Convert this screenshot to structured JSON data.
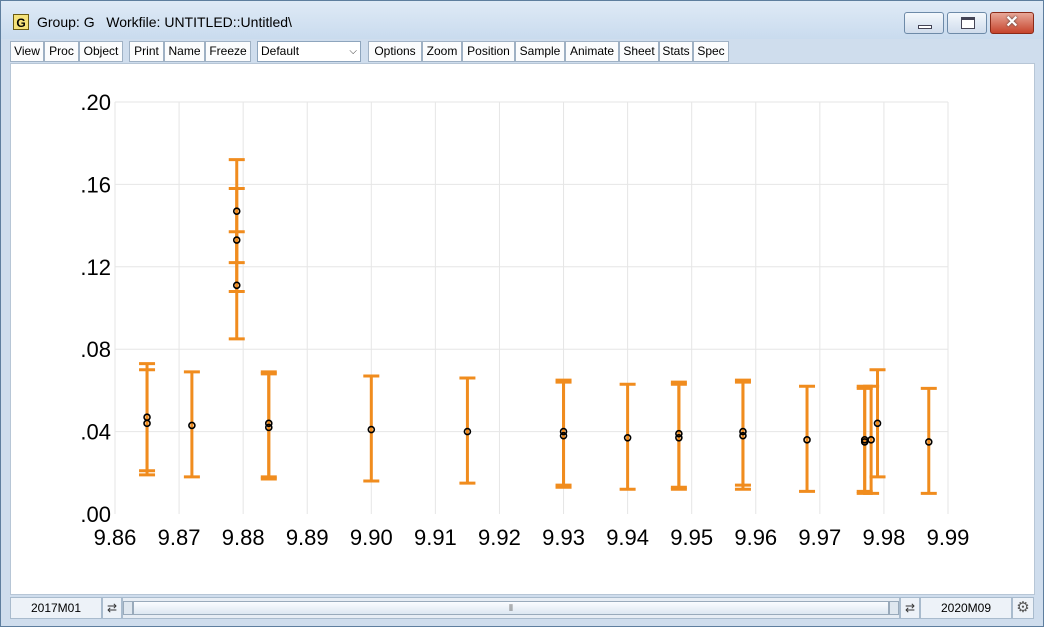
{
  "window": {
    "icon_letter": "G",
    "title": "Group: G   Workfile: UNTITLED::Untitled\\"
  },
  "toolbar": {
    "group1": [
      "View",
      "Proc",
      "Object"
    ],
    "group2": [
      "Print",
      "Name",
      "Freeze"
    ],
    "combo_value": "Default",
    "group3": [
      "Options",
      "Zoom",
      "Position",
      "Sample",
      "Animate",
      "Sheet",
      "Stats",
      "Spec"
    ]
  },
  "status": {
    "start": "2017M01",
    "end": "2020M09"
  },
  "colors": {
    "error_bar": "#f08c1e",
    "marker": "#000000",
    "grid": "#e6e6e6"
  },
  "chart_data": {
    "type": "scatter",
    "subtype": "error-bar",
    "title": "",
    "xlabel": "",
    "ylabel": "",
    "xlim": [
      9.86,
      9.99
    ],
    "ylim": [
      0.0,
      0.2
    ],
    "x_ticks": [
      "9.86",
      "9.87",
      "9.88",
      "9.89",
      "9.90",
      "9.91",
      "9.92",
      "9.93",
      "9.94",
      "9.95",
      "9.96",
      "9.97",
      "9.98",
      "9.99"
    ],
    "y_ticks": [
      ".00",
      ".04",
      ".08",
      ".12",
      ".16",
      ".20"
    ],
    "grid": true,
    "points": [
      {
        "x": 9.865,
        "y": 0.047,
        "low": 0.021,
        "high": 0.073
      },
      {
        "x": 9.865,
        "y": 0.044,
        "low": 0.019,
        "high": 0.07
      },
      {
        "x": 9.872,
        "y": 0.043,
        "low": 0.018,
        "high": 0.069
      },
      {
        "x": 9.879,
        "y": 0.147,
        "low": 0.122,
        "high": 0.172
      },
      {
        "x": 9.879,
        "y": 0.133,
        "low": 0.108,
        "high": 0.158
      },
      {
        "x": 9.879,
        "y": 0.111,
        "low": 0.085,
        "high": 0.137
      },
      {
        "x": 9.884,
        "y": 0.044,
        "low": 0.018,
        "high": 0.069
      },
      {
        "x": 9.884,
        "y": 0.042,
        "low": 0.017,
        "high": 0.068
      },
      {
        "x": 9.9,
        "y": 0.041,
        "low": 0.016,
        "high": 0.067
      },
      {
        "x": 9.915,
        "y": 0.04,
        "low": 0.015,
        "high": 0.066
      },
      {
        "x": 9.93,
        "y": 0.04,
        "low": 0.014,
        "high": 0.065
      },
      {
        "x": 9.93,
        "y": 0.038,
        "low": 0.013,
        "high": 0.064
      },
      {
        "x": 9.94,
        "y": 0.037,
        "low": 0.012,
        "high": 0.063
      },
      {
        "x": 9.948,
        "y": 0.039,
        "low": 0.013,
        "high": 0.064
      },
      {
        "x": 9.948,
        "y": 0.037,
        "low": 0.012,
        "high": 0.063
      },
      {
        "x": 9.958,
        "y": 0.04,
        "low": 0.014,
        "high": 0.065
      },
      {
        "x": 9.958,
        "y": 0.038,
        "low": 0.012,
        "high": 0.064
      },
      {
        "x": 9.968,
        "y": 0.036,
        "low": 0.011,
        "high": 0.062
      },
      {
        "x": 9.977,
        "y": 0.036,
        "low": 0.011,
        "high": 0.062
      },
      {
        "x": 9.977,
        "y": 0.035,
        "low": 0.01,
        "high": 0.061
      },
      {
        "x": 9.978,
        "y": 0.036,
        "low": 0.01,
        "high": 0.062
      },
      {
        "x": 9.979,
        "y": 0.044,
        "low": 0.018,
        "high": 0.07
      },
      {
        "x": 9.987,
        "y": 0.035,
        "low": 0.01,
        "high": 0.061
      }
    ]
  }
}
